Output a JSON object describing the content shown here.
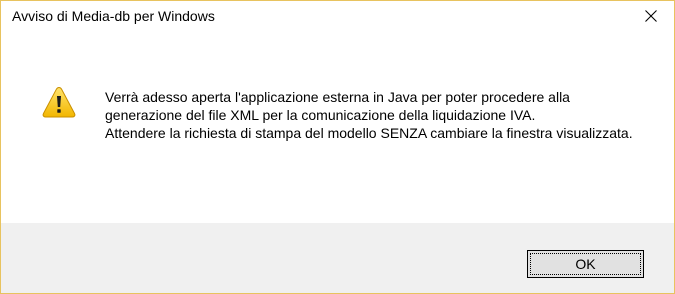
{
  "dialog": {
    "title": "Avviso di Media-db per Windows",
    "close_icon": "close-icon",
    "icon": "warning-icon",
    "message": {
      "paragraph1": "Verrà adesso aperta l'applicazione esterna in Java per poter procedere alla generazione del file XML per la comunicazione della liquidazione IVA.",
      "paragraph2": "Attendere la richiesta di stampa del modello SENZA cambiare la finestra visualizzata."
    },
    "ok_label": "OK"
  },
  "colors": {
    "window_border": "#e8c35f",
    "footer_background": "#f0f0f0",
    "button_background": "#e1e1e1",
    "warning_yellow": "#f5c518"
  }
}
